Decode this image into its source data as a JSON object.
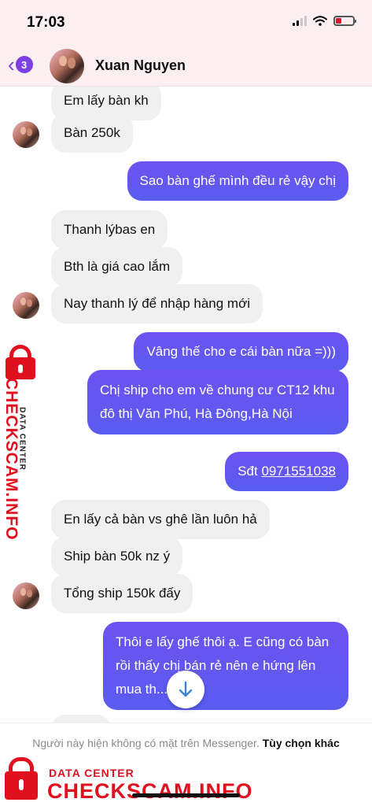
{
  "status_bar": {
    "time": "17:03",
    "icons": [
      "cellular-signal-icon",
      "wifi-icon",
      "battery-icon"
    ]
  },
  "header": {
    "back_icon": "chevron-left-icon",
    "unread_count": "3",
    "contact_name": "Xuan Nguyen"
  },
  "messages": [
    {
      "side": "in",
      "text": "Em lấy bàn kh"
    },
    {
      "side": "in",
      "text": "Bàn 250k"
    },
    {
      "side": "out",
      "text": "Sao bàn ghế mình đều rẻ vậy chị"
    },
    {
      "side": "in",
      "text": "Thanh lýbas en"
    },
    {
      "side": "in",
      "text": "Bth là giá cao lắm"
    },
    {
      "side": "in",
      "text": "Nay thanh lý để nhập hàng mới"
    },
    {
      "side": "out",
      "text": "Vâng thế cho e cái bàn nữa =)))"
    },
    {
      "side": "out",
      "text": "Chị ship cho em về chung cư CT12 khu đô thị Văn Phú, Hà Đông,Hà Nội"
    },
    {
      "side": "out",
      "text_prefix": "Sđt ",
      "phone": "0971551038"
    },
    {
      "side": "in",
      "text": "En lấy cả bàn vs ghê lần luôn hả"
    },
    {
      "side": "in",
      "text": "Ship bàn 50k nz ý"
    },
    {
      "side": "in",
      "text": "Tổng ship 150k đấy"
    },
    {
      "side": "out",
      "text": "Thôi e lấy ghế thôi ạ. E cũng có bàn rồi thấy chị bán rẻ nên e hứng lên mua th... ))"
    }
  ],
  "scroll_down_icon": "arrow-down-icon",
  "footer": {
    "notice": "Người này hiện không có mặt trên Messenger.",
    "more_options": "Tùy chọn khác"
  },
  "watermark": {
    "small": "DATA CENTER",
    "big": "CHECKSCAM.INFO",
    "icon": "padlock-icon",
    "color": "#e0101e"
  },
  "colors": {
    "accent": "#7b3fe4",
    "outgoing_bubble": "#6258f0",
    "incoming_bubble": "#f0f0f0"
  }
}
